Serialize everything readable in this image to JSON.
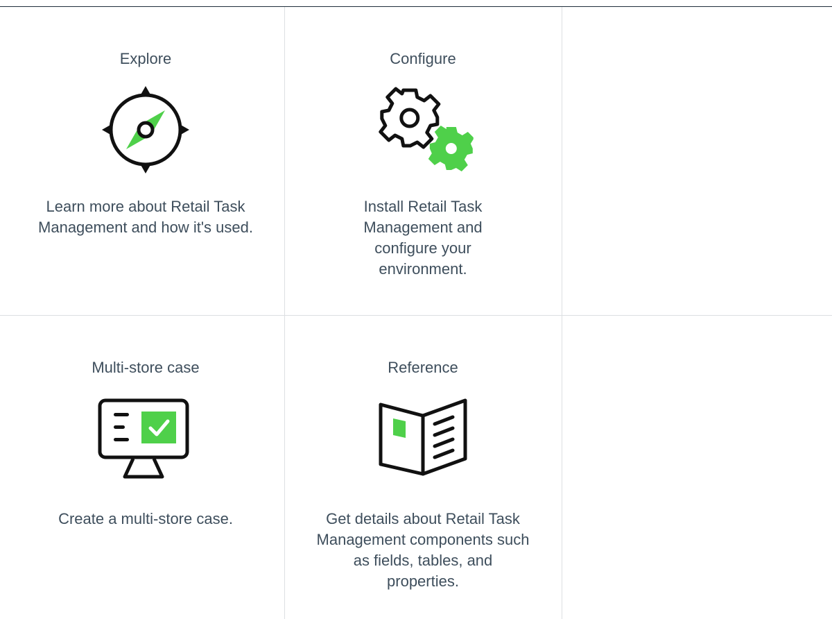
{
  "colors": {
    "accent": "#4fd04a",
    "icon_stroke": "#111111",
    "text": "#3e4e5c",
    "divider": "#dcdfe2"
  },
  "tiles": [
    {
      "title": "Explore",
      "icon": "compass-icon",
      "description": "Learn more about Retail Task Management and how it's used."
    },
    {
      "title": "Configure",
      "icon": "gears-icon",
      "description": "Install Retail Task Management and configure your environment."
    },
    {
      "title": "Multi-store case",
      "icon": "monitor-checklist-icon",
      "description": "Create a multi-store case."
    },
    {
      "title": "Reference",
      "icon": "open-book-icon",
      "description": "Get details about Retail Task Management components such as fields, tables, and properties."
    }
  ]
}
